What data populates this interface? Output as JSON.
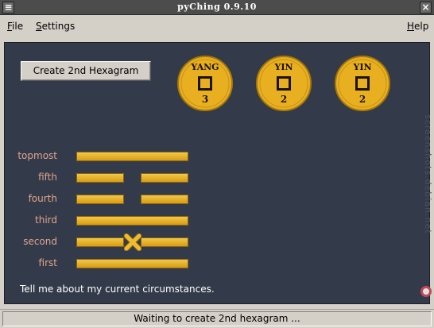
{
  "window": {
    "title": "pyChing  0.9.10",
    "close_glyph": "×"
  },
  "menu": {
    "file": {
      "accel": "F",
      "rest": "ile"
    },
    "settings": {
      "accel": "S",
      "rest": "ettings"
    },
    "help": {
      "accel": "H",
      "rest": "elp"
    }
  },
  "toolbar": {
    "create_label": "Create 2nd Hexagram"
  },
  "coins": [
    {
      "side": "YANG",
      "value": "3"
    },
    {
      "side": "YIN",
      "value": "2"
    },
    {
      "side": "YIN",
      "value": "2"
    }
  ],
  "hexagram": {
    "lines": [
      {
        "label": "topmost",
        "type": "yang"
      },
      {
        "label": "fifth",
        "type": "yin"
      },
      {
        "label": "fourth",
        "type": "yin"
      },
      {
        "label": "third",
        "type": "yang"
      },
      {
        "label": "second",
        "type": "moving-yin"
      },
      {
        "label": "first",
        "type": "yang"
      }
    ]
  },
  "question": "Tell me about my current circumstances.",
  "watermark": "screenshots.debian.net",
  "status": "Waiting to create 2nd hexagram ...",
  "colors": {
    "panel": "#333b4a",
    "gold": "#e8b020",
    "label": "#e2a38c"
  }
}
